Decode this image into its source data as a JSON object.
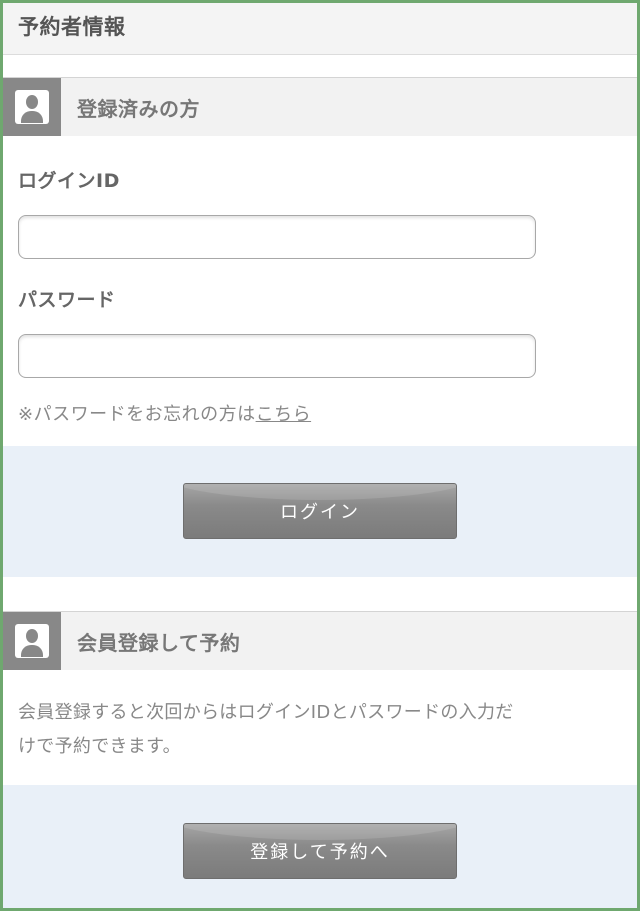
{
  "page": {
    "title": "予約者情報"
  },
  "login_section": {
    "title": "登録済みの方",
    "login_id_label": "ログインID",
    "login_id_value": "",
    "password_label": "パスワード",
    "password_value": "",
    "forgot_text": "※パスワードをお忘れの方は",
    "forgot_link": "こちら",
    "login_button": "ログイン"
  },
  "register_section": {
    "title": "会員登録して予約",
    "description_line1": "会員登録すると次回からはログインIDとパスワードの入力だ",
    "description_line2": "けで予約できます。",
    "register_button": "登録して予約へ"
  },
  "icons": {
    "section_icon": "user-icon"
  },
  "colors": {
    "frame_border": "#6fa86f",
    "action_band": "#e9f0f8",
    "button": "#888888"
  }
}
